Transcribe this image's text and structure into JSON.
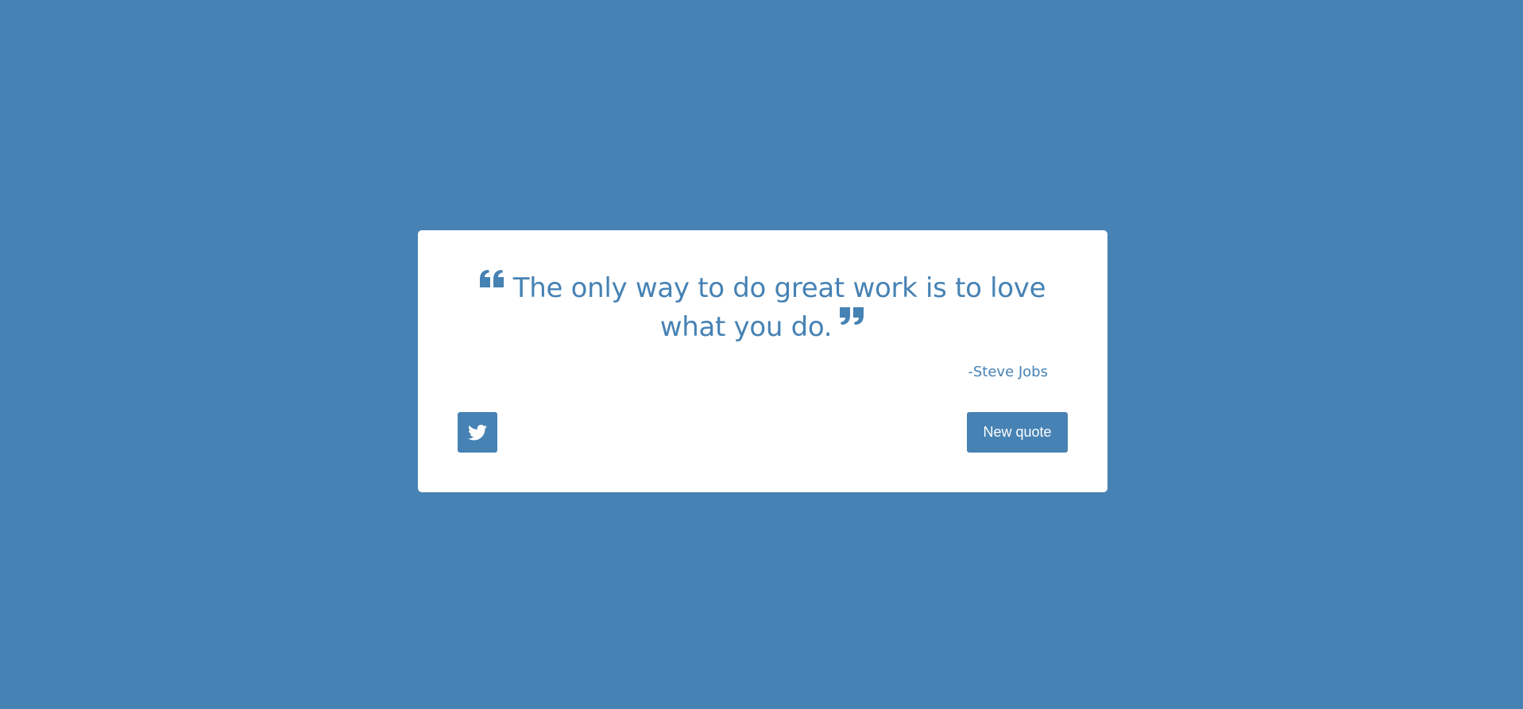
{
  "theme": {
    "background_color": "#4682b4",
    "card_color": "#ffffff",
    "accent_color": "#4682b4"
  },
  "quote": {
    "open_icon": "quote-left-icon",
    "text": "The only way to do great work is to love what you do.",
    "close_icon": "quote-right-icon",
    "author": "-Steve Jobs"
  },
  "actions": {
    "tweet_icon": "twitter-icon",
    "new_quote_label": "New quote"
  }
}
